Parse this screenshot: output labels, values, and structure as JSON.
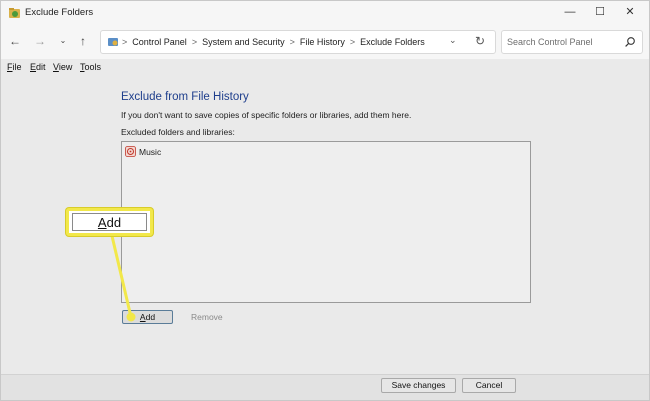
{
  "window": {
    "title": "Exclude Folders",
    "controls": {
      "minimize": "—",
      "maximize": "☐",
      "close": "✕"
    }
  },
  "nav": {
    "back": "←",
    "forward": "→",
    "recent": "⌄",
    "up": "↑",
    "breadcrumb": [
      "Control Panel",
      "System and Security",
      "File History",
      "Exclude Folders"
    ],
    "separator": ">",
    "dropdown": "⌄",
    "refresh": "↻",
    "search_placeholder": "Search Control Panel"
  },
  "menu": {
    "items": [
      {
        "first": "F",
        "rest": "ile"
      },
      {
        "first": "E",
        "rest": "dit"
      },
      {
        "first": "V",
        "rest": "iew"
      },
      {
        "first": "T",
        "rest": "ools"
      }
    ]
  },
  "main": {
    "heading": "Exclude from File History",
    "description": "If you don't want to save copies of specific folders or libraries, add them here.",
    "list_label": "Excluded folders and libraries:",
    "excluded_items": [
      "Music"
    ],
    "add_button": {
      "first": "A",
      "rest": "dd"
    },
    "remove_button": "Remove"
  },
  "footer": {
    "save_button": "Save changes",
    "cancel_button": "Cancel"
  },
  "callout": {
    "text_first": "A",
    "text_rest": "dd",
    "color": "#f2e84a"
  },
  "colors": {
    "heading": "#1e3e8c",
    "highlight": "#f2e84a"
  }
}
